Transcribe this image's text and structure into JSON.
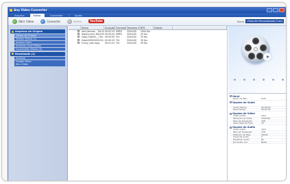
{
  "window": {
    "title": "Any Video Converter"
  },
  "menu": [
    {
      "label": "Arquivo",
      "active": false
    },
    {
      "label": "Editar",
      "active": true
    },
    {
      "label": "Converter",
      "active": false
    },
    {
      "label": "Ajuda",
      "active": false
    }
  ],
  "toolbar": {
    "add_label": "Abrir Vídeo",
    "convert_label": "Converter",
    "home_label": "Home",
    "youtube_label": "YouTube"
  },
  "profile": {
    "label": "Modo",
    "value": "Filme AVI Personalizado (*.avi)"
  },
  "sidebar": {
    "groups": [
      {
        "title": "Arquivos de Origem",
        "items": [
          "Videos de Origem",
          "Tarefas Vídeos (1)",
          "Arquivo Flash",
          "Arquivos Local Vídeos",
          "Conversões Vídeos (4)"
        ]
      },
      {
        "title": "Downloads (1)",
        "items": [
          "YouTube",
          "Google Video",
          "Nico Vídeo"
        ]
      }
    ]
  },
  "filelist": {
    "columns": [
      "",
      "Nome",
      "Duração",
      "Formato",
      "Tamanho d...",
      "BPS",
      "Estado"
    ],
    "rows": [
      [
        "Jack Johnson - The N...",
        "00:02:34",
        "MPEG",
        "320x240",
        "2000 fps"
      ],
      [
        "www.brunei_2801009...",
        "00:00:04",
        "MPEG",
        "320x240",
        "25 fps"
      ],
      [
        "Good_Fightin_-_The...",
        "00:00:00",
        "FLV",
        "320x240",
        "30 fps"
      ],
      [
        "Super00000001002...",
        "00:00:20",
        "FLV",
        "320x240",
        "30 fps"
      ],
      [
        "Funny_cats.mpg",
        "00:01:22",
        "FLV",
        "320x240",
        "30 fps"
      ]
    ]
  },
  "properties": {
    "sections": [
      {
        "title": "Geral",
        "rows": [
          [
            "Gerar de Tam.",
            "Auto"
          ]
        ]
      },
      {
        "title": "Opções de Saída",
        "rows": [
          [
            "",
            ""
          ],
          [
            "Iniciar Tempo",
            "00:00:00"
          ],
          [
            "Parar Tempo",
            "00:02:34"
          ]
        ]
      },
      {
        "title": "Opções de Vídeo",
        "rows": [
          [
            "Video Codec",
            "mp4"
          ],
          [
            "Tamanho de Vídeo",
            "320x240"
          ],
          [
            "Taxa de Transação",
            "768"
          ],
          [
            "Velocidade de Fcps",
            "25"
          ]
        ]
      },
      {
        "title": "Opções de Áudio",
        "rows": [
          [
            "Áudio Codec",
            "mp3"
          ],
          [
            "Taxa de Transação",
            "128"
          ],
          [
            "Exemplo de Taxa",
            "44100"
          ],
          [
            "Canal de Áudio",
            "2"
          ],
          [
            "Desativar Áudio",
            "No"
          ],
          [
            "Dicionário Á-V",
            "Baixo"
          ]
        ]
      }
    ]
  },
  "colors": {
    "title_bar": "#1c4ea8",
    "sidebar_header": "#1f55a8",
    "accent": "#2c5bb0"
  }
}
